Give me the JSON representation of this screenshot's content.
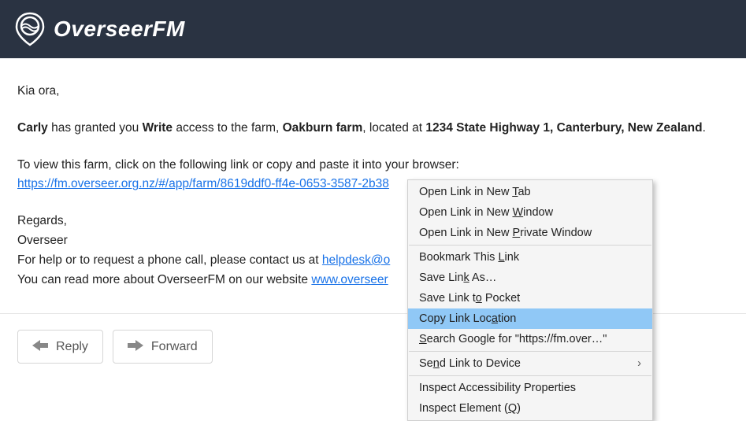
{
  "header": {
    "brand": "OverseerFM"
  },
  "email": {
    "greeting": "Kia ora,",
    "grant": {
      "granter": "Carly",
      "text1": " has granted you ",
      "access_level": "Write",
      "text2": " access to the farm, ",
      "farm_name": "Oakburn farm",
      "text3": ", located at ",
      "address": "1234 State Highway 1, Canterbury, New Zealand",
      "trail": "."
    },
    "view_instruction": "To view this farm, click on the following link or copy and paste it into your browser:",
    "farm_link": "https://fm.overseer.org.nz/#/app/farm/8619ddf0-ff4e-0653-3587-2b38",
    "signoff_regards": "Regards,",
    "signoff_name": "Overseer",
    "help_prefix": "For help or to request a phone call, please contact us at ",
    "help_email": "helpdesk@o",
    "about_prefix": "You can read more about OverseerFM on our website ",
    "about_link": "www.overseer"
  },
  "actions": {
    "reply": "Reply",
    "forward": "Forward"
  },
  "context_menu": {
    "items": [
      {
        "pre": "Open Link in New ",
        "u": "T",
        "post": "ab"
      },
      {
        "pre": "Open Link in New ",
        "u": "W",
        "post": "indow"
      },
      {
        "pre": "Open Link in New ",
        "u": "P",
        "post": "rivate Window"
      }
    ],
    "items2": [
      {
        "pre": "Bookmark This ",
        "u": "L",
        "post": "ink"
      },
      {
        "pre": "Save Lin",
        "u": "k",
        "post": " As…"
      },
      {
        "pre": "Save Link t",
        "u": "o",
        "post": " Pocket"
      },
      {
        "pre": "Copy Link Loc",
        "u": "a",
        "post": "tion",
        "highlight": true
      },
      {
        "pre": "",
        "u": "S",
        "post": "earch Google for \"https://fm.over…\""
      }
    ],
    "items3": [
      {
        "pre": "Se",
        "u": "n",
        "post": "d Link to Device",
        "submenu": true
      }
    ],
    "items4": [
      {
        "pre": "Inspect Accessibility Properties",
        "u": "",
        "post": ""
      },
      {
        "pre": "Inspect Element (",
        "u": "Q",
        "post": ")"
      }
    ]
  }
}
